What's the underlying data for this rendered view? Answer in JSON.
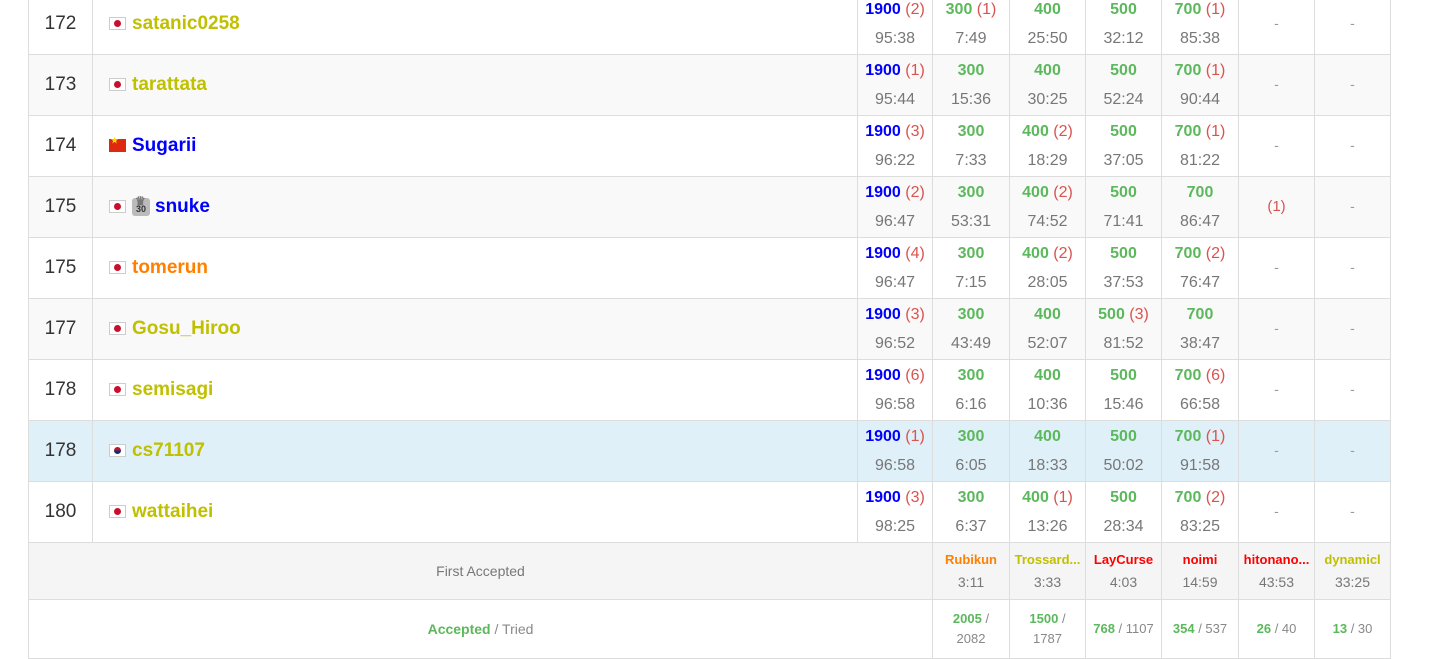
{
  "rows": [
    {
      "rank": "172",
      "flag": "jp",
      "user": "satanic0258",
      "color": "u-yellow",
      "crown": false,
      "bg": "",
      "total": {
        "pts": "1900",
        "pen": "(2)",
        "time": "95:38"
      },
      "probs": [
        {
          "pts": "300",
          "pen": "(1)",
          "time": "7:49"
        },
        {
          "pts": "400",
          "pen": "",
          "time": "25:50"
        },
        {
          "pts": "500",
          "pen": "",
          "time": "32:12"
        },
        {
          "pts": "700",
          "pen": "(1)",
          "time": "85:38"
        },
        {
          "dash": "-"
        },
        {
          "dash": "-"
        }
      ]
    },
    {
      "rank": "173",
      "flag": "jp",
      "user": "tarattata",
      "color": "u-yellow",
      "crown": false,
      "bg": "alt",
      "total": {
        "pts": "1900",
        "pen": "(1)",
        "time": "95:44"
      },
      "probs": [
        {
          "pts": "300",
          "pen": "",
          "time": "15:36"
        },
        {
          "pts": "400",
          "pen": "",
          "time": "30:25"
        },
        {
          "pts": "500",
          "pen": "",
          "time": "52:24"
        },
        {
          "pts": "700",
          "pen": "(1)",
          "time": "90:44"
        },
        {
          "dash": "-"
        },
        {
          "dash": "-"
        }
      ]
    },
    {
      "rank": "174",
      "flag": "cn",
      "user": "Sugarii",
      "color": "u-blue",
      "crown": false,
      "bg": "",
      "total": {
        "pts": "1900",
        "pen": "(3)",
        "time": "96:22"
      },
      "probs": [
        {
          "pts": "300",
          "pen": "",
          "time": "7:33"
        },
        {
          "pts": "400",
          "pen": "(2)",
          "time": "18:29"
        },
        {
          "pts": "500",
          "pen": "",
          "time": "37:05"
        },
        {
          "pts": "700",
          "pen": "(1)",
          "time": "81:22"
        },
        {
          "dash": "-"
        },
        {
          "dash": "-"
        }
      ]
    },
    {
      "rank": "175",
      "flag": "jp",
      "user": "snuke",
      "color": "u-blue",
      "crown": true,
      "crown_text": "30",
      "bg": "alt",
      "total": {
        "pts": "1900",
        "pen": "(2)",
        "time": "96:47"
      },
      "probs": [
        {
          "pts": "300",
          "pen": "",
          "time": "53:31"
        },
        {
          "pts": "400",
          "pen": "(2)",
          "time": "74:52"
        },
        {
          "pts": "500",
          "pen": "",
          "time": "71:41"
        },
        {
          "pts": "700",
          "pen": "",
          "time": "86:47"
        },
        {
          "wa": "(1)"
        },
        {
          "dash": "-"
        }
      ]
    },
    {
      "rank": "175",
      "flag": "jp",
      "user": "tomerun",
      "color": "u-orange",
      "crown": false,
      "bg": "",
      "total": {
        "pts": "1900",
        "pen": "(4)",
        "time": "96:47"
      },
      "probs": [
        {
          "pts": "300",
          "pen": "",
          "time": "7:15"
        },
        {
          "pts": "400",
          "pen": "(2)",
          "time": "28:05"
        },
        {
          "pts": "500",
          "pen": "",
          "time": "37:53"
        },
        {
          "pts": "700",
          "pen": "(2)",
          "time": "76:47"
        },
        {
          "dash": "-"
        },
        {
          "dash": "-"
        }
      ]
    },
    {
      "rank": "177",
      "flag": "jp",
      "user": "Gosu_Hiroo",
      "color": "u-yellow",
      "crown": false,
      "bg": "alt",
      "total": {
        "pts": "1900",
        "pen": "(3)",
        "time": "96:52"
      },
      "probs": [
        {
          "pts": "300",
          "pen": "",
          "time": "43:49"
        },
        {
          "pts": "400",
          "pen": "",
          "time": "52:07"
        },
        {
          "pts": "500",
          "pen": "(3)",
          "time": "81:52"
        },
        {
          "pts": "700",
          "pen": "",
          "time": "38:47"
        },
        {
          "dash": "-"
        },
        {
          "dash": "-"
        }
      ]
    },
    {
      "rank": "178",
      "flag": "jp",
      "user": "semisagi",
      "color": "u-yellow",
      "crown": false,
      "bg": "",
      "total": {
        "pts": "1900",
        "pen": "(6)",
        "time": "96:58"
      },
      "probs": [
        {
          "pts": "300",
          "pen": "",
          "time": "6:16"
        },
        {
          "pts": "400",
          "pen": "",
          "time": "10:36"
        },
        {
          "pts": "500",
          "pen": "",
          "time": "15:46"
        },
        {
          "pts": "700",
          "pen": "(6)",
          "time": "66:58"
        },
        {
          "dash": "-"
        },
        {
          "dash": "-"
        }
      ]
    },
    {
      "rank": "178",
      "flag": "kr",
      "user": "cs71107",
      "color": "u-yellow",
      "crown": false,
      "bg": "hl",
      "total": {
        "pts": "1900",
        "pen": "(1)",
        "time": "96:58"
      },
      "probs": [
        {
          "pts": "300",
          "pen": "",
          "time": "6:05"
        },
        {
          "pts": "400",
          "pen": "",
          "time": "18:33"
        },
        {
          "pts": "500",
          "pen": "",
          "time": "50:02"
        },
        {
          "pts": "700",
          "pen": "(1)",
          "time": "91:58"
        },
        {
          "dash": "-"
        },
        {
          "dash": "-"
        }
      ]
    },
    {
      "rank": "180",
      "flag": "jp",
      "user": "wattaihei",
      "color": "u-yellow",
      "crown": false,
      "bg": "",
      "total": {
        "pts": "1900",
        "pen": "(3)",
        "time": "98:25"
      },
      "probs": [
        {
          "pts": "300",
          "pen": "",
          "time": "6:37"
        },
        {
          "pts": "400",
          "pen": "(1)",
          "time": "13:26"
        },
        {
          "pts": "500",
          "pen": "",
          "time": "28:34"
        },
        {
          "pts": "700",
          "pen": "(2)",
          "time": "83:25"
        },
        {
          "dash": "-"
        },
        {
          "dash": "-"
        }
      ]
    }
  ],
  "first_accepted": {
    "label": "First Accepted",
    "items": [
      {
        "name": "Rubikun",
        "time": "3:11",
        "color": "c-orange"
      },
      {
        "name": "Trossard...",
        "time": "3:33",
        "color": "c-yellow"
      },
      {
        "name": "LayCurse",
        "time": "4:03",
        "color": "c-red"
      },
      {
        "name": "noimi",
        "time": "14:59",
        "color": "c-red"
      },
      {
        "name": "hitonano...",
        "time": "43:53",
        "color": "c-red"
      },
      {
        "name": "dynamicl",
        "time": "33:25",
        "color": "c-yellow"
      }
    ]
  },
  "accepted": {
    "label_accepted": "Accepted",
    "label_sep": " / ",
    "label_tried": "Tried",
    "items": [
      {
        "acc": "2005",
        "tried": "2082",
        "wrap": true
      },
      {
        "acc": "1500",
        "tried": "1787",
        "wrap": true
      },
      {
        "acc": "768",
        "tried": "1107",
        "wrap": false
      },
      {
        "acc": "354",
        "tried": "537",
        "wrap": false
      },
      {
        "acc": "26",
        "tried": "40",
        "wrap": false
      },
      {
        "acc": "13",
        "tried": "30",
        "wrap": false
      }
    ]
  },
  "colors": {
    "accepted": "#5cb85c",
    "penalty": "#d9534f",
    "total": "#0000ff",
    "highlight_row": "#dff0f8"
  }
}
